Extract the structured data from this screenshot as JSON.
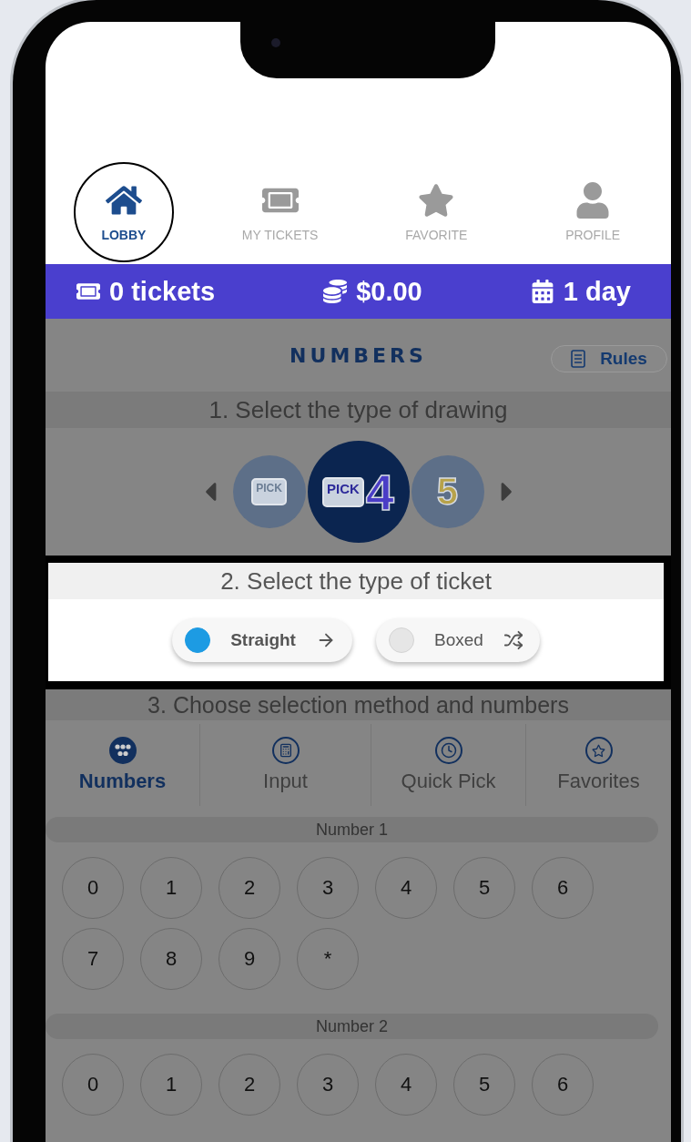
{
  "nav": [
    {
      "kind": "home",
      "label": "LOBBY",
      "selected": true,
      "circled": true
    },
    {
      "kind": "ticket",
      "label": "MY TICKETS",
      "selected": false,
      "circled": false
    },
    {
      "kind": "star",
      "label": "FAVORITE",
      "selected": false,
      "circled": false
    },
    {
      "kind": "person",
      "label": "PROFILE",
      "selected": false,
      "circled": false
    }
  ],
  "summary": [
    {
      "kind": "tickets",
      "text": "0 tickets"
    },
    {
      "kind": "balance",
      "text": "$0.00"
    },
    {
      "kind": "days",
      "text": "1 day"
    }
  ],
  "game": {
    "title": "NUMBERS",
    "rules_button": "Rules"
  },
  "step1": {
    "heading": "1. Select the type of drawing",
    "highlighted": false,
    "games": [
      {
        "word": "PICK",
        "selected": false
      },
      {
        "word": "PICK",
        "digit": "4",
        "selected": true
      },
      {
        "digit": "5",
        "selected": false
      }
    ]
  },
  "step2": {
    "heading": "2. Select the type of ticket",
    "highlighted": true,
    "options": [
      {
        "kind": "straight",
        "label": "Straight",
        "selected": true
      },
      {
        "kind": "boxed",
        "label": "Boxed",
        "selected": false
      }
    ]
  },
  "step3": {
    "heading": "3. Choose selection method and numbers",
    "highlighted": false,
    "methods": [
      {
        "kind": "numbers",
        "label": "Numbers",
        "selected": true
      },
      {
        "kind": "input",
        "label": "Input",
        "selected": false
      },
      {
        "kind": "quick",
        "label": "Quick Pick",
        "selected": false
      },
      {
        "kind": "favorites",
        "label": "Favorites",
        "selected": false
      }
    ],
    "number_groups": [
      {
        "title": "Number 1",
        "balls": [
          "0",
          "1",
          "2",
          "3",
          "4",
          "5",
          "6",
          "7",
          "8",
          "9",
          "*"
        ]
      },
      {
        "title": "Number 2",
        "balls": [
          "0",
          "1",
          "2",
          "3",
          "4",
          "5",
          "6"
        ]
      }
    ]
  }
}
